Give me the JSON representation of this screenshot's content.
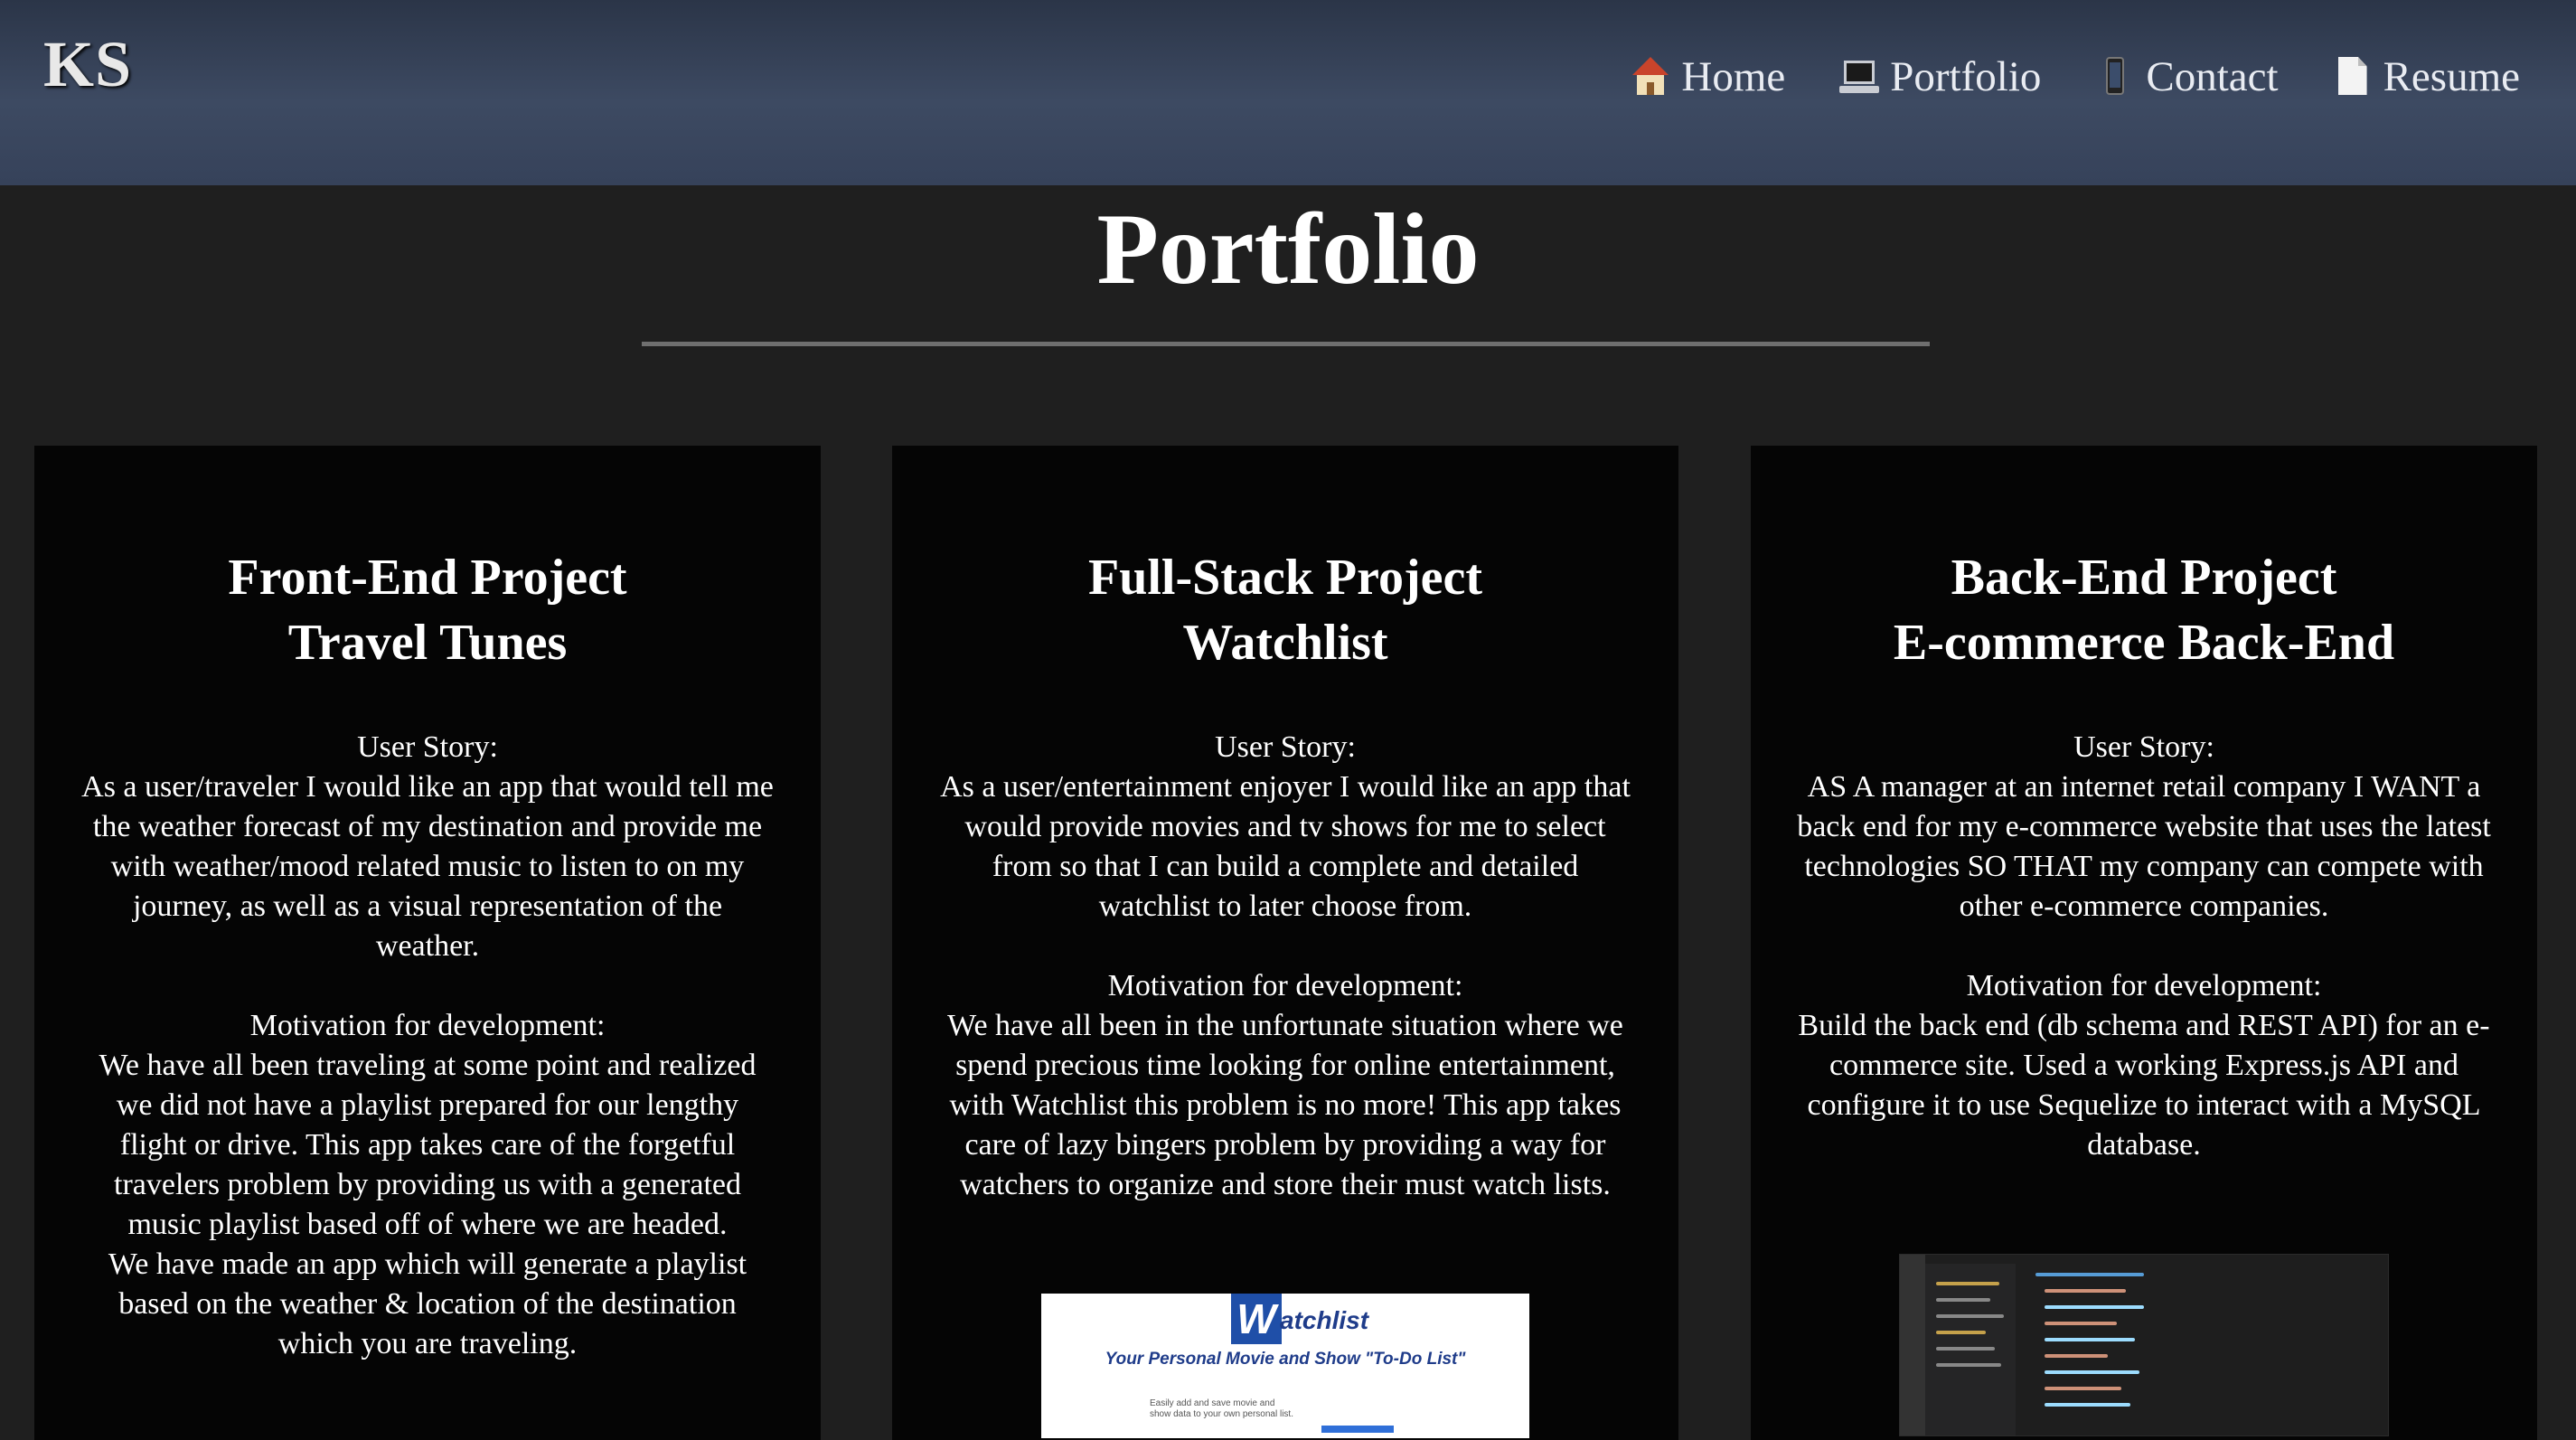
{
  "header": {
    "logo": "KS",
    "nav": [
      {
        "label": "Home",
        "icon": "house-icon"
      },
      {
        "label": "Portfolio",
        "icon": "laptop-icon"
      },
      {
        "label": "Contact",
        "icon": "phone-icon"
      },
      {
        "label": "Resume",
        "icon": "document-icon"
      }
    ]
  },
  "main": {
    "title": "Portfolio",
    "cards": [
      {
        "title_line1": "Front-End Project",
        "title_line2": "Travel Tunes",
        "story_label": "User Story:",
        "story": "As a user/traveler I would like an app that would tell me the weather forecast of my destination and provide me with weather/mood related music to listen to on my journey, as well as a visual representation of the weather.",
        "motivation_label": "Motivation for development:",
        "motivation": "We have all been traveling at some point and realized we did not have a playlist prepared for our lengthy flight or drive. This app takes care of the forgetful travelers problem by providing us with a generated music playlist based off of where we are headed.",
        "motivation_extra": "We have made an app which will generate a playlist based on the weather & location of the destination which you are traveling."
      },
      {
        "title_line1": "Full-Stack Project",
        "title_line2": "Watchlist",
        "story_label": "User Story:",
        "story": "As a user/entertainment enjoyer I would like an app that would provide movies and tv shows for me to select from so that I can build a complete and detailed watchlist to later choose from.",
        "motivation_label": "Motivation for development:",
        "motivation": "We have all been in the unfortunate situation where we spend precious time looking for online entertainment, with Watchlist this problem is no more! This app takes care of lazy bingers problem by providing a way for watchers to organize and store their must watch lists.",
        "image": {
          "logo_letter": "W",
          "logo_text": "atchlist",
          "tagline": "Your Personal Movie and Show \"To-Do List\"",
          "small_text": "Easily add and save movie and show data to your own personal list."
        }
      },
      {
        "title_line1": "Back-End Project",
        "title_line2": "E-commerce Back-End",
        "story_label": "User Story:",
        "story": "AS A manager at an internet retail company I WANT a back end for my e-commerce website that uses the latest technologies SO THAT my company can compete with other e-commerce companies.",
        "motivation_label": "Motivation for development:",
        "motivation": "Build the back end (db schema and REST API) for an e-commerce site. Used a working Express.js API and configure it to use Sequelize to interact with a MySQL database."
      }
    ]
  },
  "colors": {
    "header_gradient_top": "#2b3548",
    "header_gradient_mid": "#3d4a62",
    "page_background": "#1f1f1f",
    "card_background": "#050505",
    "rule": "#6f6f6f"
  }
}
